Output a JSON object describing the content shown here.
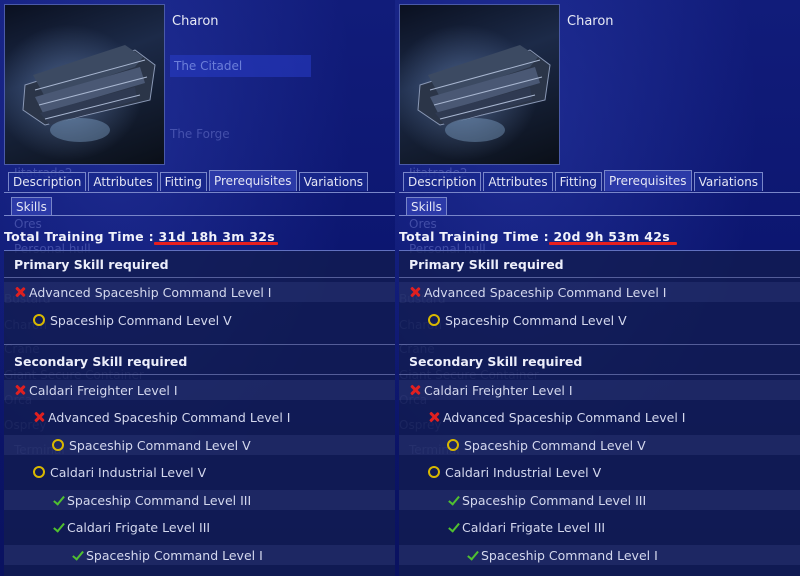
{
  "panels": [
    {
      "ship_name": "Charon",
      "location": "The Citadel",
      "tabs": [
        "Description",
        "Attributes",
        "Fitting",
        "Prerequisites",
        "Variations"
      ],
      "active_tab": "Prerequisites",
      "subtab": "Skills",
      "total_label": "Total Training Time :",
      "total_value": "31d 18h 3m 32s",
      "primary_header": "Primary Skill required",
      "secondary_header": "Secondary Skill required",
      "primary_skills": [
        {
          "status": "missing",
          "label": "Advanced Spaceship Command Level I"
        },
        {
          "status": "partial",
          "label": "Spaceship Command Level V"
        }
      ],
      "secondary_skills": [
        {
          "status": "missing",
          "label": "Caldari Freighter Level I"
        },
        {
          "status": "missing",
          "label": "Advanced Spaceship Command Level I"
        },
        {
          "status": "partial",
          "label": "Spaceship Command Level V"
        },
        {
          "status": "partial",
          "label": "Caldari Industrial Level V"
        },
        {
          "status": "trained",
          "label": "Spaceship Command Level III"
        },
        {
          "status": "trained",
          "label": "Caldari Frigate Level III"
        },
        {
          "status": "trained",
          "label": "Spaceship Command Level I"
        }
      ]
    },
    {
      "ship_name": "Charon",
      "location": "",
      "tabs": [
        "Description",
        "Attributes",
        "Fitting",
        "Prerequisites",
        "Variations"
      ],
      "active_tab": "Prerequisites",
      "subtab": "Skills",
      "total_label": "Total Training Time :",
      "total_value": "20d 9h 53m 42s",
      "primary_header": "Primary Skill required",
      "secondary_header": "Secondary Skill required",
      "primary_skills": [
        {
          "status": "missing",
          "label": "Advanced Spaceship Command Level I"
        },
        {
          "status": "partial",
          "label": "Spaceship Command Level V"
        }
      ],
      "secondary_skills": [
        {
          "status": "missing",
          "label": "Caldari Freighter Level I"
        },
        {
          "status": "missing",
          "label": "Advanced Spaceship Command Level I"
        },
        {
          "status": "partial",
          "label": "Spaceship Command Level V"
        },
        {
          "status": "partial",
          "label": "Caldari Industrial Level V"
        },
        {
          "status": "trained",
          "label": "Spaceship Command Level III"
        },
        {
          "status": "trained",
          "label": "Caldari Frigate Level III"
        },
        {
          "status": "trained",
          "label": "Spaceship Command Level I"
        }
      ]
    }
  ],
  "colors": {
    "missing": "#e02020",
    "partial": "#d8b800",
    "trained": "#50c030",
    "underline": "#e81f1f"
  },
  "icons": {
    "missing": "red-x-icon",
    "partial": "yellow-circle-icon",
    "trained": "green-check-icon"
  }
}
